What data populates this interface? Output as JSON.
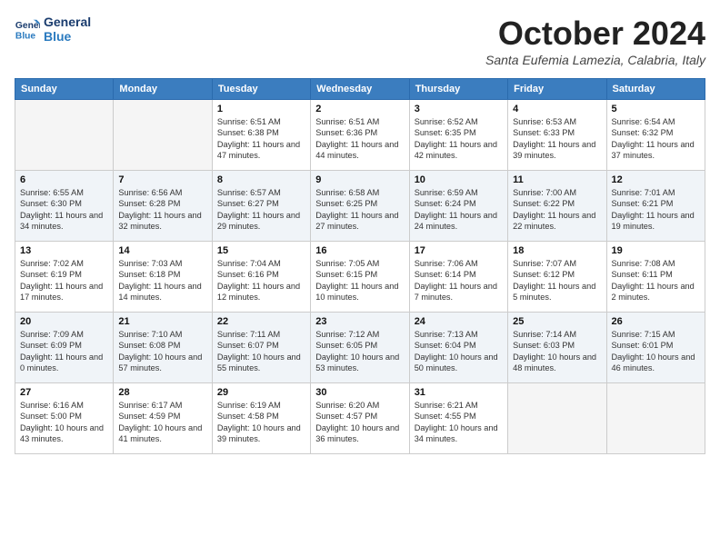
{
  "header": {
    "logo_line1": "General",
    "logo_line2": "Blue",
    "month_title": "October 2024",
    "location": "Santa Eufemia Lamezia, Calabria, Italy"
  },
  "days_of_week": [
    "Sunday",
    "Monday",
    "Tuesday",
    "Wednesday",
    "Thursday",
    "Friday",
    "Saturday"
  ],
  "weeks": [
    [
      {
        "day": null
      },
      {
        "day": null
      },
      {
        "day": 1,
        "sunrise": "Sunrise: 6:51 AM",
        "sunset": "Sunset: 6:38 PM",
        "daylight": "Daylight: 11 hours and 47 minutes."
      },
      {
        "day": 2,
        "sunrise": "Sunrise: 6:51 AM",
        "sunset": "Sunset: 6:36 PM",
        "daylight": "Daylight: 11 hours and 44 minutes."
      },
      {
        "day": 3,
        "sunrise": "Sunrise: 6:52 AM",
        "sunset": "Sunset: 6:35 PM",
        "daylight": "Daylight: 11 hours and 42 minutes."
      },
      {
        "day": 4,
        "sunrise": "Sunrise: 6:53 AM",
        "sunset": "Sunset: 6:33 PM",
        "daylight": "Daylight: 11 hours and 39 minutes."
      },
      {
        "day": 5,
        "sunrise": "Sunrise: 6:54 AM",
        "sunset": "Sunset: 6:32 PM",
        "daylight": "Daylight: 11 hours and 37 minutes."
      }
    ],
    [
      {
        "day": 6,
        "sunrise": "Sunrise: 6:55 AM",
        "sunset": "Sunset: 6:30 PM",
        "daylight": "Daylight: 11 hours and 34 minutes."
      },
      {
        "day": 7,
        "sunrise": "Sunrise: 6:56 AM",
        "sunset": "Sunset: 6:28 PM",
        "daylight": "Daylight: 11 hours and 32 minutes."
      },
      {
        "day": 8,
        "sunrise": "Sunrise: 6:57 AM",
        "sunset": "Sunset: 6:27 PM",
        "daylight": "Daylight: 11 hours and 29 minutes."
      },
      {
        "day": 9,
        "sunrise": "Sunrise: 6:58 AM",
        "sunset": "Sunset: 6:25 PM",
        "daylight": "Daylight: 11 hours and 27 minutes."
      },
      {
        "day": 10,
        "sunrise": "Sunrise: 6:59 AM",
        "sunset": "Sunset: 6:24 PM",
        "daylight": "Daylight: 11 hours and 24 minutes."
      },
      {
        "day": 11,
        "sunrise": "Sunrise: 7:00 AM",
        "sunset": "Sunset: 6:22 PM",
        "daylight": "Daylight: 11 hours and 22 minutes."
      },
      {
        "day": 12,
        "sunrise": "Sunrise: 7:01 AM",
        "sunset": "Sunset: 6:21 PM",
        "daylight": "Daylight: 11 hours and 19 minutes."
      }
    ],
    [
      {
        "day": 13,
        "sunrise": "Sunrise: 7:02 AM",
        "sunset": "Sunset: 6:19 PM",
        "daylight": "Daylight: 11 hours and 17 minutes."
      },
      {
        "day": 14,
        "sunrise": "Sunrise: 7:03 AM",
        "sunset": "Sunset: 6:18 PM",
        "daylight": "Daylight: 11 hours and 14 minutes."
      },
      {
        "day": 15,
        "sunrise": "Sunrise: 7:04 AM",
        "sunset": "Sunset: 6:16 PM",
        "daylight": "Daylight: 11 hours and 12 minutes."
      },
      {
        "day": 16,
        "sunrise": "Sunrise: 7:05 AM",
        "sunset": "Sunset: 6:15 PM",
        "daylight": "Daylight: 11 hours and 10 minutes."
      },
      {
        "day": 17,
        "sunrise": "Sunrise: 7:06 AM",
        "sunset": "Sunset: 6:14 PM",
        "daylight": "Daylight: 11 hours and 7 minutes."
      },
      {
        "day": 18,
        "sunrise": "Sunrise: 7:07 AM",
        "sunset": "Sunset: 6:12 PM",
        "daylight": "Daylight: 11 hours and 5 minutes."
      },
      {
        "day": 19,
        "sunrise": "Sunrise: 7:08 AM",
        "sunset": "Sunset: 6:11 PM",
        "daylight": "Daylight: 11 hours and 2 minutes."
      }
    ],
    [
      {
        "day": 20,
        "sunrise": "Sunrise: 7:09 AM",
        "sunset": "Sunset: 6:09 PM",
        "daylight": "Daylight: 11 hours and 0 minutes."
      },
      {
        "day": 21,
        "sunrise": "Sunrise: 7:10 AM",
        "sunset": "Sunset: 6:08 PM",
        "daylight": "Daylight: 10 hours and 57 minutes."
      },
      {
        "day": 22,
        "sunrise": "Sunrise: 7:11 AM",
        "sunset": "Sunset: 6:07 PM",
        "daylight": "Daylight: 10 hours and 55 minutes."
      },
      {
        "day": 23,
        "sunrise": "Sunrise: 7:12 AM",
        "sunset": "Sunset: 6:05 PM",
        "daylight": "Daylight: 10 hours and 53 minutes."
      },
      {
        "day": 24,
        "sunrise": "Sunrise: 7:13 AM",
        "sunset": "Sunset: 6:04 PM",
        "daylight": "Daylight: 10 hours and 50 minutes."
      },
      {
        "day": 25,
        "sunrise": "Sunrise: 7:14 AM",
        "sunset": "Sunset: 6:03 PM",
        "daylight": "Daylight: 10 hours and 48 minutes."
      },
      {
        "day": 26,
        "sunrise": "Sunrise: 7:15 AM",
        "sunset": "Sunset: 6:01 PM",
        "daylight": "Daylight: 10 hours and 46 minutes."
      }
    ],
    [
      {
        "day": 27,
        "sunrise": "Sunrise: 6:16 AM",
        "sunset": "Sunset: 5:00 PM",
        "daylight": "Daylight: 10 hours and 43 minutes."
      },
      {
        "day": 28,
        "sunrise": "Sunrise: 6:17 AM",
        "sunset": "Sunset: 4:59 PM",
        "daylight": "Daylight: 10 hours and 41 minutes."
      },
      {
        "day": 29,
        "sunrise": "Sunrise: 6:19 AM",
        "sunset": "Sunset: 4:58 PM",
        "daylight": "Daylight: 10 hours and 39 minutes."
      },
      {
        "day": 30,
        "sunrise": "Sunrise: 6:20 AM",
        "sunset": "Sunset: 4:57 PM",
        "daylight": "Daylight: 10 hours and 36 minutes."
      },
      {
        "day": 31,
        "sunrise": "Sunrise: 6:21 AM",
        "sunset": "Sunset: 4:55 PM",
        "daylight": "Daylight: 10 hours and 34 minutes."
      },
      {
        "day": null
      },
      {
        "day": null
      }
    ]
  ]
}
